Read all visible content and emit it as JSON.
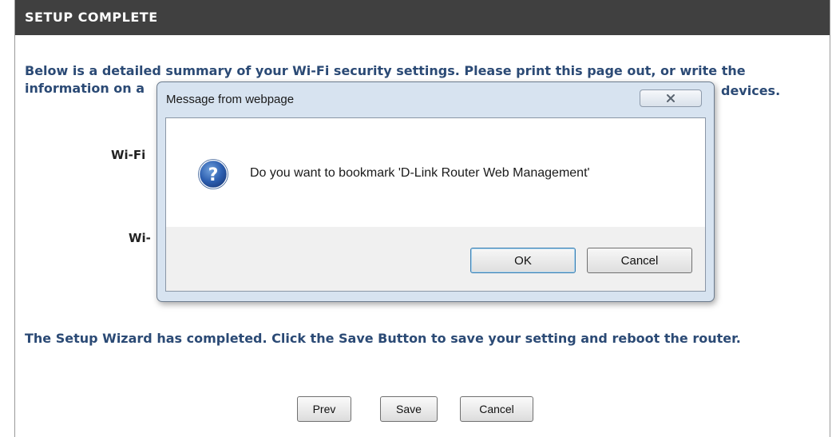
{
  "page": {
    "header_title": "SETUP COMPLETE",
    "summary_text": "Below is a detailed summary of your Wi-Fi security settings. Please print this page out, or write the information on a",
    "summary_tail": "devices.",
    "label_wifi_1": "Wi-Fi",
    "label_wifi_2": "Wi-",
    "complete_text": "The Setup Wizard has completed. Click the Save Button to save your setting and reboot the router.",
    "buttons": {
      "prev": "Prev",
      "save": "Save",
      "cancel": "Cancel"
    }
  },
  "dialog": {
    "title": "Message from webpage",
    "message": "Do you want to bookmark 'D-Link Router Web Management'",
    "ok_label": "OK",
    "cancel_label": "Cancel",
    "close_icon": "close-icon",
    "question_icon": "question-icon"
  },
  "colors": {
    "header_bg": "#404040",
    "text_blue": "#2b4a75",
    "dialog_frame": "#d7e3f0"
  }
}
